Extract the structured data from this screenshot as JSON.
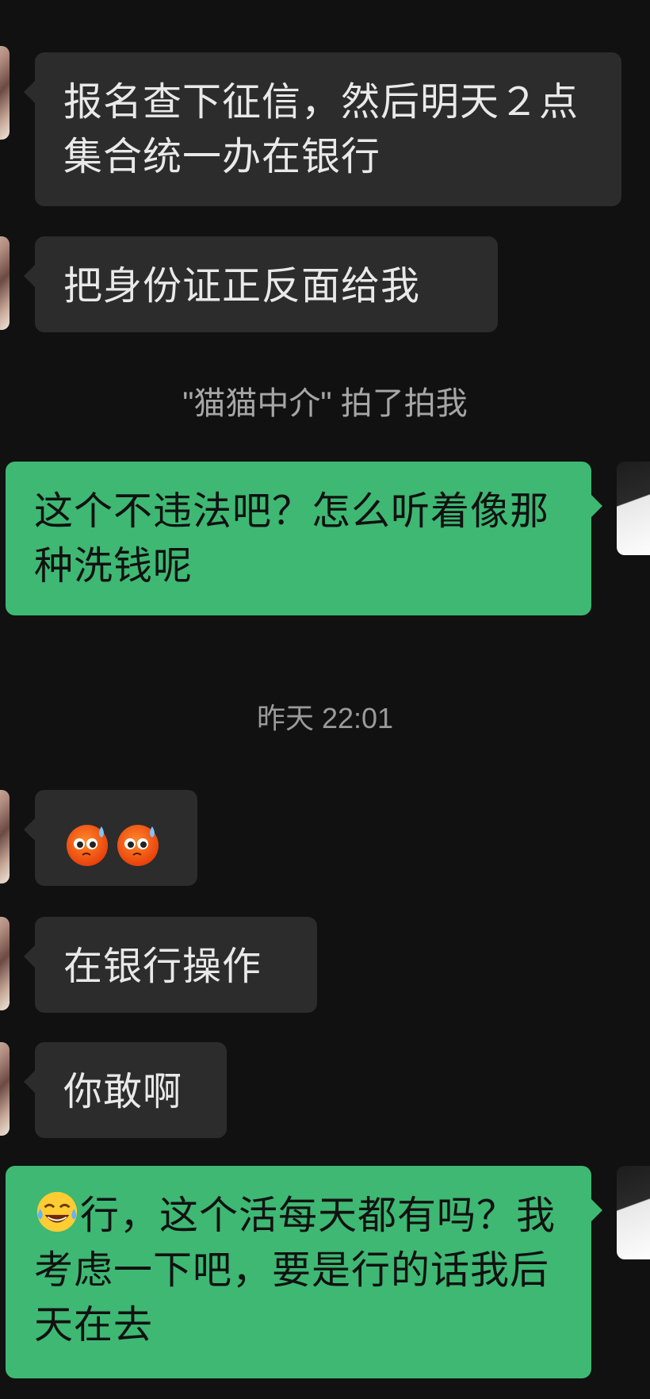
{
  "messages": [
    {
      "direction": "in",
      "text": "报名查下征信，然后明天２点集合统一办在银行"
    },
    {
      "direction": "in",
      "text": "把身份证正反面给我"
    },
    {
      "direction": "out",
      "text": "这个不违法吧？怎么听着像那种洗钱呢"
    },
    {
      "direction": "in",
      "emojis": [
        "sweating-face-emoji",
        "sweating-face-emoji"
      ]
    },
    {
      "direction": "in",
      "text": "在银行操作"
    },
    {
      "direction": "in",
      "text": "你敢啊"
    },
    {
      "direction": "out",
      "emoji": "tears-of-joy-emoji",
      "text": "行，这个活每天都有吗？我考虑一下吧，要是行的话我后天在去"
    }
  ],
  "system": {
    "pat_notice": "\"猫猫中介\" 拍了拍我",
    "timestamp": "昨天 22:01"
  },
  "colors": {
    "background": "#111111",
    "incoming_bubble": "#2c2c2c",
    "outgoing_bubble": "#3eb873",
    "system_text": "#9a9a9a"
  }
}
